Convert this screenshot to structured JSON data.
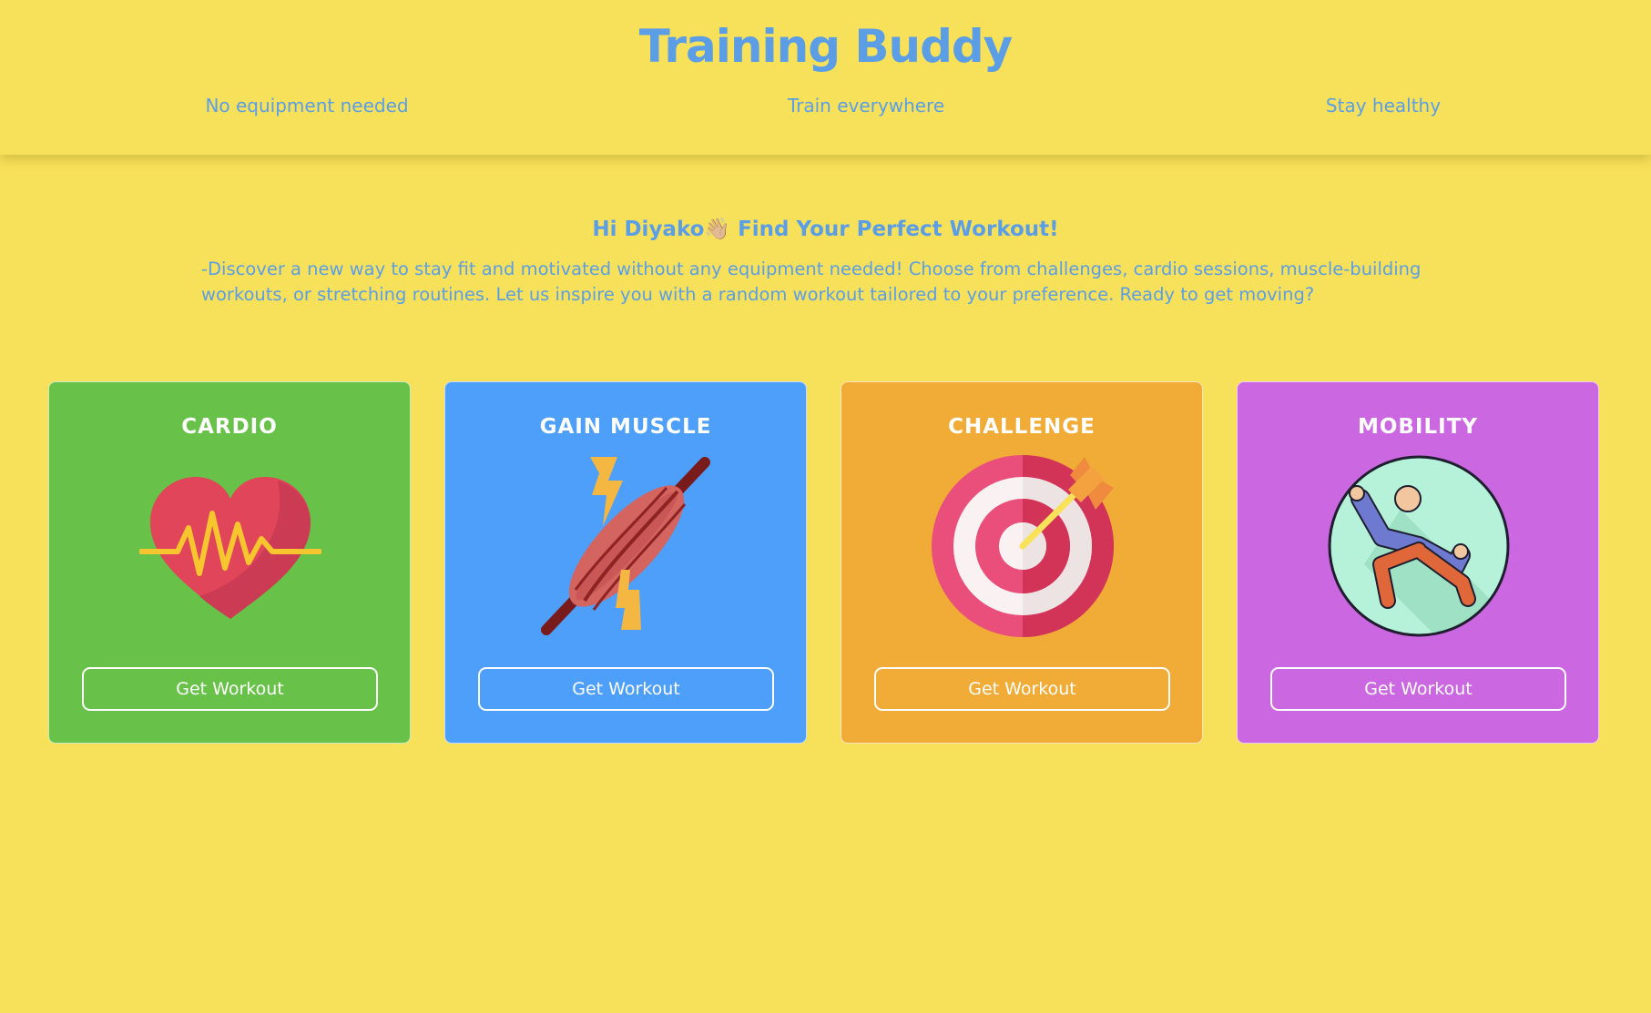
{
  "header": {
    "title": "Training Buddy",
    "taglines": [
      "No equipment needed",
      "Train everywhere",
      "Stay healthy"
    ]
  },
  "main": {
    "greeting": "Hi Diyako👋🏼 Find Your Perfect Workout!",
    "intro": "-Discover a new way to stay fit and motivated without any equipment needed! Choose from challenges, cardio sessions, muscle-building workouts, or stretching routines. Let us inspire you with a random workout tailored to your preference. Ready to get moving?"
  },
  "cards": [
    {
      "title": "CARDIO",
      "button": "Get Workout",
      "color": "#68C24A",
      "icon": "heartbeat-icon"
    },
    {
      "title": "GAIN MUSCLE",
      "button": "Get Workout",
      "color": "#4D9FFA",
      "icon": "muscle-icon"
    },
    {
      "title": "CHALLENGE",
      "button": "Get Workout",
      "color": "#F0AC37",
      "icon": "target-icon"
    },
    {
      "title": "MOBILITY",
      "button": "Get Workout",
      "color": "#CB67E0",
      "icon": "stretching-person-icon"
    }
  ]
}
